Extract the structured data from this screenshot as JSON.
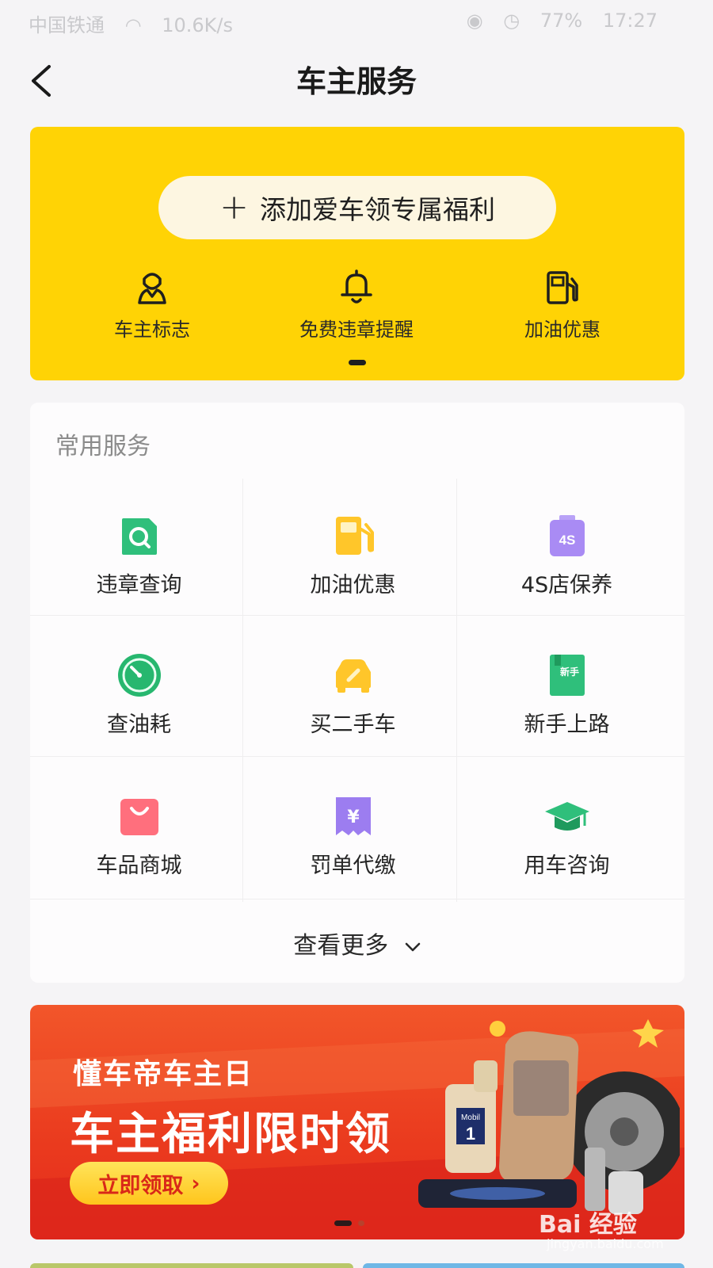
{
  "status_bar": {
    "carrier": "中国铁通",
    "speed": "10.6K/s",
    "battery": "77%",
    "time": "17:27"
  },
  "nav": {
    "title": "车主服务"
  },
  "promo": {
    "add_car_label": "添加爱车领专属福利",
    "items": [
      {
        "label": "车主标志",
        "icon": "driver-badge-icon"
      },
      {
        "label": "免费违章提醒",
        "icon": "bell-icon"
      },
      {
        "label": "加油优惠",
        "icon": "fuel-pump-icon"
      }
    ]
  },
  "services": {
    "title": "常用服务",
    "items": [
      {
        "label": "违章查询",
        "icon": "violation-query-icon",
        "color": "#2fbf7b"
      },
      {
        "label": "加油优惠",
        "icon": "fuel-discount-icon",
        "color": "#ffc62a"
      },
      {
        "label": "4S店保养",
        "icon": "4s-maintenance-icon",
        "color": "#a98bf4",
        "icon_text": "4S"
      },
      {
        "label": "查油耗",
        "icon": "fuel-gauge-icon",
        "color": "#27b76f"
      },
      {
        "label": "买二手车",
        "icon": "used-car-icon",
        "color": "#ffc62a"
      },
      {
        "label": "新手上路",
        "icon": "novice-book-icon",
        "color": "#2fbf7b",
        "icon_text": "新手"
      },
      {
        "label": "车品商城",
        "icon": "shopping-bag-icon",
        "color": "#ff6f7d"
      },
      {
        "label": "罚单代缴",
        "icon": "fine-payment-icon",
        "color": "#9c7df0",
        "icon_text": "¥"
      },
      {
        "label": "用车咨询",
        "icon": "graduation-cap-icon",
        "color": "#2fbf7b"
      }
    ],
    "see_more": "查看更多"
  },
  "banner": {
    "subtitle": "懂车帝车主日",
    "title": "车主福利限时领",
    "button": "立即领取"
  },
  "watermark": {
    "text": "Bai 经验",
    "url_text": "jingyan.baidu.com"
  }
}
